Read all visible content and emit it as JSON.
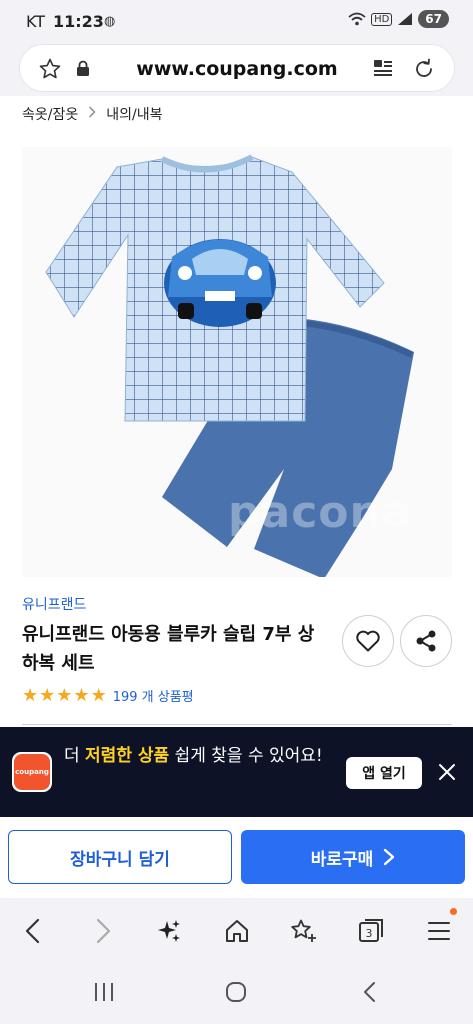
{
  "status_bar": {
    "carrier": "KT",
    "time": "11:23",
    "battery": "67",
    "network": "HD"
  },
  "browser": {
    "url": "www.coupang.com",
    "tab_count": "3"
  },
  "breadcrumb": {
    "items": [
      "속옷/잠옷",
      "내의/내복"
    ]
  },
  "product": {
    "watermark": "pacona",
    "brand": "유니프랜드",
    "title": "유니프랜드 아동용 블루카 슬립 7부 상하복 세트",
    "rating": 5,
    "review_count_label": "199 개 상품평"
  },
  "app_banner": {
    "text_before": "더 ",
    "text_highlight": "저렴한 상품",
    "text_after": " 쉽게 찾을 수 있어요!",
    "logo_text": "coupang",
    "open_button": "앱 열기"
  },
  "actions": {
    "cart": "장바구니 담기",
    "buy": "바로구매"
  },
  "colors": {
    "accent_blue": "#2a6ff3",
    "star": "#f6a81e",
    "banner_bg": "#0d1227",
    "highlight": "#ffd21f"
  }
}
